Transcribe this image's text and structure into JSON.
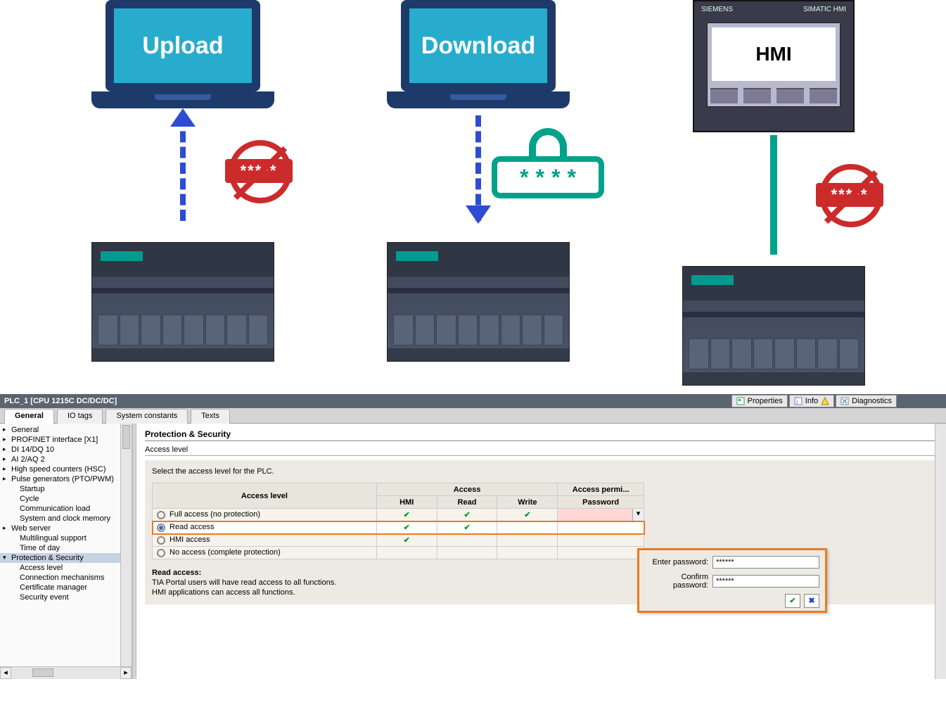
{
  "diagram": {
    "laptop1": "Upload",
    "laptop2": "Download",
    "hmi_brand": "SIEMENS",
    "hmi_model": "SIMATIC HMI",
    "hmi_text": "HMI",
    "pad_mask": "****"
  },
  "titlebar": {
    "title": "PLC_1 [CPU 1215C DC/DC/DC]",
    "buttons": {
      "properties": "Properties",
      "info": "Info",
      "diagnostics": "Diagnostics"
    }
  },
  "tabs": {
    "general": "General",
    "io": "IO tags",
    "sys": "System constants",
    "texts": "Texts"
  },
  "tree": {
    "items": [
      {
        "label": "General",
        "level": 1
      },
      {
        "label": "PROFINET interface [X1]",
        "level": 1
      },
      {
        "label": "DI 14/DQ 10",
        "level": 1
      },
      {
        "label": "AI 2/AQ 2",
        "level": 1
      },
      {
        "label": "High speed counters (HSC)",
        "level": 1
      },
      {
        "label": "Pulse generators (PTO/PWM)",
        "level": 1
      },
      {
        "label": "Startup",
        "level": 2
      },
      {
        "label": "Cycle",
        "level": 2
      },
      {
        "label": "Communication load",
        "level": 2
      },
      {
        "label": "System and clock memory",
        "level": 2
      },
      {
        "label": "Web server",
        "level": 1
      },
      {
        "label": "Multilingual support",
        "level": 2
      },
      {
        "label": "Time of day",
        "level": 2
      },
      {
        "label": "Protection & Security",
        "level": 1,
        "open": true,
        "selected": true
      },
      {
        "label": "Access level",
        "level": 2
      },
      {
        "label": "Connection mechanisms",
        "level": 2
      },
      {
        "label": "Certificate manager",
        "level": 2
      },
      {
        "label": "Security event",
        "level": 2
      }
    ]
  },
  "main": {
    "heading": "Protection & Security",
    "subheading": "Access level",
    "instruction": "Select the access level for the PLC.",
    "table": {
      "cols": {
        "access_level": "Access level",
        "access": "Access",
        "hmi": "HMI",
        "read": "Read",
        "write": "Write",
        "perm": "Access permi...",
        "pwd": "Password"
      },
      "rows": [
        {
          "label": "Full access (no protection)",
          "hmi": true,
          "read": true,
          "write": true,
          "pwd_cell": true
        },
        {
          "label": "Read access",
          "hmi": true,
          "read": true,
          "write": false,
          "selected": true
        },
        {
          "label": "HMI access",
          "hmi": true,
          "read": false,
          "write": false
        },
        {
          "label": "No access (complete protection)",
          "hmi": false,
          "read": false,
          "write": false
        }
      ]
    },
    "pwd_popup": {
      "enter": "Enter password:",
      "confirm": "Confirm password:",
      "value": "******"
    },
    "note_title": "Read access:",
    "note_line1": "TIA Portal users will have read access to all functions.",
    "note_line2": "HMI applications can access all functions."
  }
}
